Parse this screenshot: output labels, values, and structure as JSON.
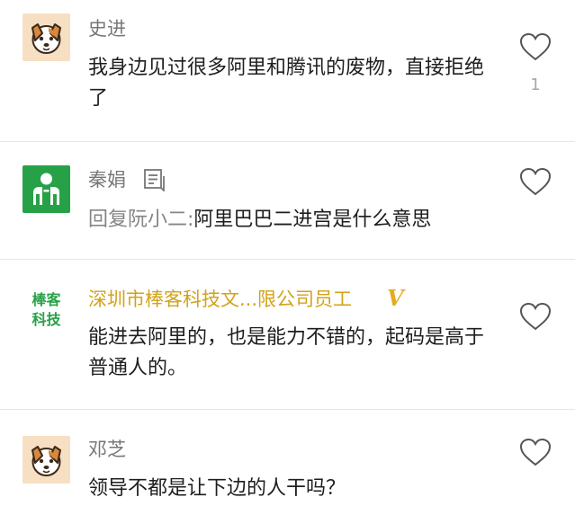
{
  "comments": [
    {
      "author": "史进",
      "avatar": "dog-avatar-icon",
      "text": "我身边见过很多阿里和腾讯的废物，直接拒绝了",
      "likes": "1"
    },
    {
      "author": "秦娟",
      "avatar": "green-person-avatar-icon",
      "author_icon": "note-icon",
      "reply_prefix": "回复阮小二:",
      "text": "阿里巴巴二进宫是什么意思"
    },
    {
      "author": "深圳市棒客科技文...限公司员工",
      "avatar_text_line1": "棒客",
      "avatar_text_line2": "科技",
      "verified_badge": "V",
      "text": "能进去阿里的，也是能力不错的，起码是高于普通人的。"
    },
    {
      "author": "邓芝",
      "avatar": "dog-avatar-icon",
      "text": "领导不都是让下边的人干吗？"
    }
  ],
  "colors": {
    "author_gray": "#777777",
    "author_gold": "#d1a31a",
    "verified_badge": "#e3ad1e",
    "avatar_green": "#27a147",
    "dog_bg": "#f6dfc2",
    "divider": "#e6e6e6"
  }
}
